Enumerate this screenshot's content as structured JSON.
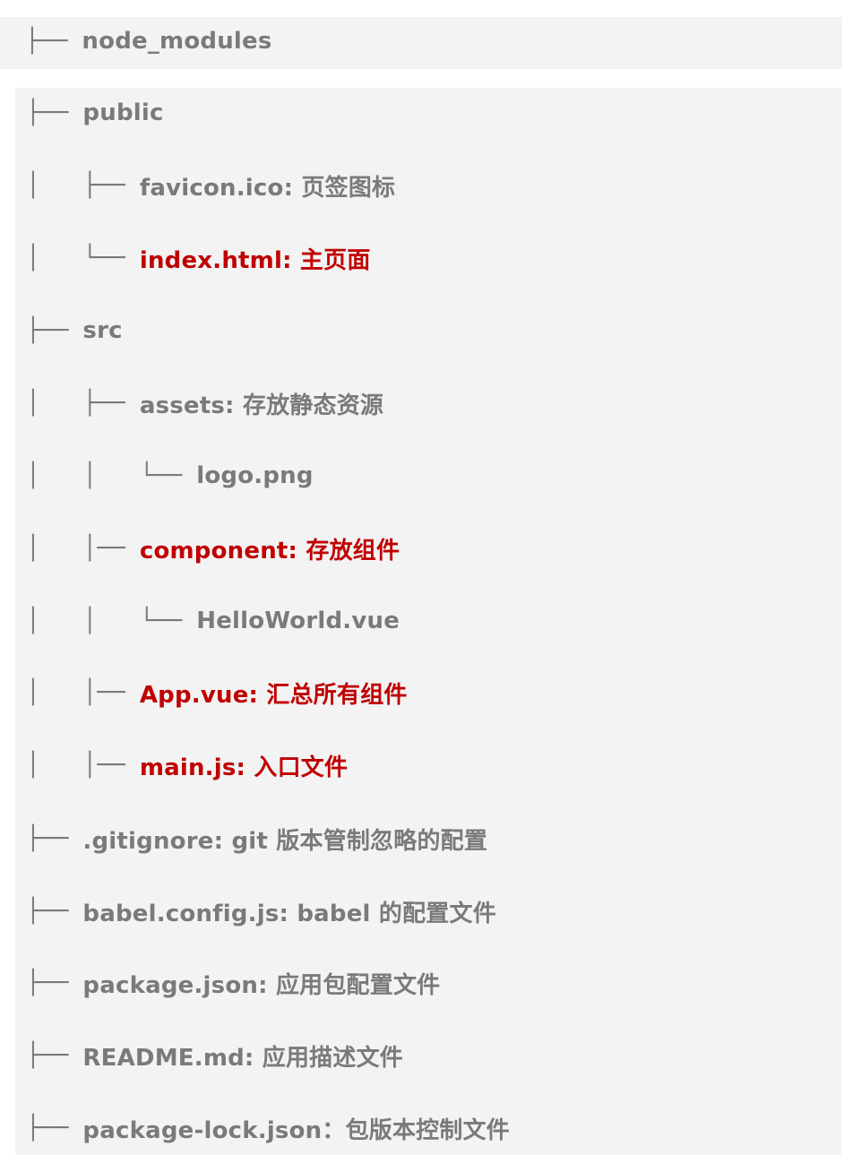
{
  "colors": {
    "background": "#f3f3f3",
    "normal_text": "#7a7a7a",
    "highlight_text": "#c00000"
  },
  "tree": [
    {
      "prefix": "├── ",
      "text": "node_modules",
      "highlight": false
    },
    {
      "prefix": "├── ",
      "text": "public",
      "highlight": false
    },
    {
      "prefix": "│   ├── ",
      "text": "favicon.ico: 页签图标",
      "highlight": false
    },
    {
      "prefix": "│   └── ",
      "text": "index.html: 主页面",
      "highlight": true
    },
    {
      "prefix": "├── ",
      "text": "src",
      "highlight": false
    },
    {
      "prefix": "│   ├── ",
      "text": "assets: 存放静态资源",
      "highlight": false
    },
    {
      "prefix": "│   │   └── ",
      "text": "logo.png",
      "highlight": false
    },
    {
      "prefix": "│   │── ",
      "text": "component: 存放组件",
      "highlight": true
    },
    {
      "prefix": "│   │   └── ",
      "text": "HelloWorld.vue",
      "highlight": false
    },
    {
      "prefix": "│   │── ",
      "text": "App.vue: 汇总所有组件",
      "highlight": true
    },
    {
      "prefix": "│   │── ",
      "text": "main.js: 入口文件",
      "highlight": true
    },
    {
      "prefix": "├── ",
      "text": ".gitignore: git 版本管制忽略的配置",
      "highlight": false
    },
    {
      "prefix": "├── ",
      "text": "babel.config.js: babel 的配置文件",
      "highlight": false
    },
    {
      "prefix": "├── ",
      "text": "package.json: 应用包配置文件",
      "highlight": false
    },
    {
      "prefix": "├── ",
      "text": "README.md: 应用描述文件",
      "highlight": false
    },
    {
      "prefix": "├── ",
      "text": "package-lock.json：包版本控制文件",
      "highlight": false
    }
  ]
}
